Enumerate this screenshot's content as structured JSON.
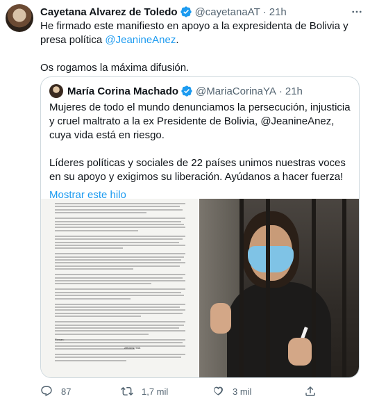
{
  "tweet": {
    "author_name": "Cayetana Alvarez de Toledo",
    "author_handle": "@cayetanaAT",
    "separator": "·",
    "time": "21h",
    "more_icon": "ellipsis-icon",
    "text_line1_prefix": "He firmado este manifiesto en apoyo a la expresidenta de Bolivia y presa política ",
    "text_mention": "@JeanineAnez",
    "text_line1_suffix": ".",
    "text_para2": "Os rogamos la máxima difusión."
  },
  "quote": {
    "author_name": "María Corina Machado",
    "author_handle": "@MariaCorinaYA",
    "separator": "·",
    "time": "21h",
    "para1": "Mujeres de todo el mundo denunciamos la persecución, injusticia y cruel maltrato a la ex Presidente de Bolivia, @JeanineAnez, cuya vida está en riesgo.",
    "para2": "Líderes políticas y sociales de 22 países unimos nuestras voces en su apoyo y exigimos su liberación. Ayúdanos a hacer fuerza!",
    "show_thread": "Mostrar este hilo",
    "document_heading": "ARGENTINA",
    "document_signer_label": "Firman:"
  },
  "actions": {
    "replies": "87",
    "retweets": "1,7 mil",
    "likes": "3 mil"
  },
  "colors": {
    "accent": "#1d9bf0",
    "text": "#0f1419",
    "muted": "#536471",
    "border": "#cfd9de"
  }
}
